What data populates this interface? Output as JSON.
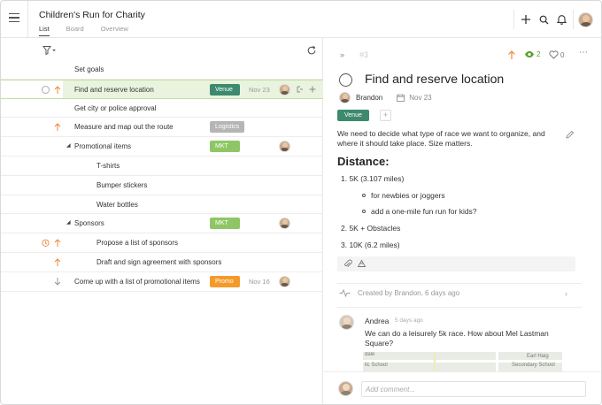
{
  "header": {
    "project_title": "Children's Run for Charity",
    "tabs": [
      {
        "label": "List",
        "active": true
      },
      {
        "label": "Board",
        "active": false
      },
      {
        "label": "Overview",
        "active": false
      }
    ]
  },
  "tasks": [
    {
      "title": "Set goals",
      "level": 0,
      "status": "none",
      "priority": "none",
      "tag": "",
      "tag_color": "",
      "date": "",
      "avatar": false,
      "expander": false
    },
    {
      "title": "Find and reserve location",
      "level": 0,
      "status": "circle",
      "priority": "up",
      "tag": "Venue",
      "tag_color": "#3d8a6e",
      "date": "Nov 23",
      "avatar": true,
      "expander": false,
      "selected": true
    },
    {
      "title": "Get city or police approval",
      "level": 0,
      "status": "none",
      "priority": "none",
      "tag": "",
      "tag_color": "",
      "date": "",
      "avatar": false,
      "expander": false
    },
    {
      "title": "Measure and map out the route",
      "level": 0,
      "status": "none",
      "priority": "up",
      "tag": "Logistics",
      "tag_color": "#b5b5b5",
      "date": "",
      "avatar": false,
      "expander": false
    },
    {
      "title": "Promotional items",
      "level": 0,
      "status": "none",
      "priority": "none",
      "tag": "MKT",
      "tag_color": "#8fc665",
      "date": "",
      "avatar": true,
      "expander": true
    },
    {
      "title": "T-shirts",
      "level": 1,
      "status": "none",
      "priority": "none",
      "tag": "",
      "tag_color": "",
      "date": "",
      "avatar": false,
      "expander": false
    },
    {
      "title": "Bumper stickers",
      "level": 1,
      "status": "none",
      "priority": "none",
      "tag": "",
      "tag_color": "",
      "date": "",
      "avatar": false,
      "expander": false
    },
    {
      "title": "Water bottles",
      "level": 1,
      "status": "none",
      "priority": "none",
      "tag": "",
      "tag_color": "",
      "date": "",
      "avatar": false,
      "expander": false
    },
    {
      "title": "Sponsors",
      "level": 0,
      "status": "none",
      "priority": "none",
      "tag": "MKT",
      "tag_color": "#8fc665",
      "date": "",
      "avatar": true,
      "expander": true
    },
    {
      "title": "Propose a list of sponsors",
      "level": 1,
      "status": "timer",
      "priority": "up",
      "tag": "",
      "tag_color": "",
      "date": "",
      "avatar": false,
      "expander": false
    },
    {
      "title": "Draft and sign agreement with sponsors",
      "level": 1,
      "status": "none",
      "priority": "up",
      "tag": "",
      "tag_color": "",
      "date": "",
      "avatar": false,
      "expander": false
    },
    {
      "title": "Come up with a list of promotional items",
      "level": 0,
      "status": "none",
      "priority": "down",
      "tag": "Promo",
      "tag_color": "#f39a2b",
      "date": "Nov 16",
      "avatar": true,
      "expander": false
    }
  ],
  "detail": {
    "number": "#3",
    "watchers_count": "2",
    "likes_count": "0",
    "title": "Find and reserve location",
    "assignee": "Brandon",
    "due_date": "Nov 23",
    "tag": "Venue",
    "description": "We need to decide what type of race we want to organize, and where it should take place. Size matters.",
    "heading": "Distance:",
    "list": [
      {
        "text": "1. 5K (3.107 miles)",
        "level": 0
      },
      {
        "text": "for newbies or joggers",
        "level": 1
      },
      {
        "text": "add a one-mile fun run for kids?",
        "level": 1
      },
      {
        "text": "2. 5K + Obstacles",
        "level": 0
      },
      {
        "text": "3. 10K (6.2 miles)",
        "level": 0
      }
    ],
    "activity": "Created by Brandon, 6 days ago",
    "comment": {
      "author": "Andrea",
      "time": "5 days ago",
      "text": "We can do a leisurely 5k race. How about Mel Lastman Square?"
    },
    "map_labels": [
      "dale",
      "lic School",
      "Earl Haig",
      "Secondary School"
    ],
    "comment_placeholder": "Add comment..."
  },
  "colors": {
    "selected_row_bg": "#e9f3de",
    "accent_green": "#5aa02c",
    "priority_orange": "#f0863a",
    "priority_down": "#999999"
  }
}
